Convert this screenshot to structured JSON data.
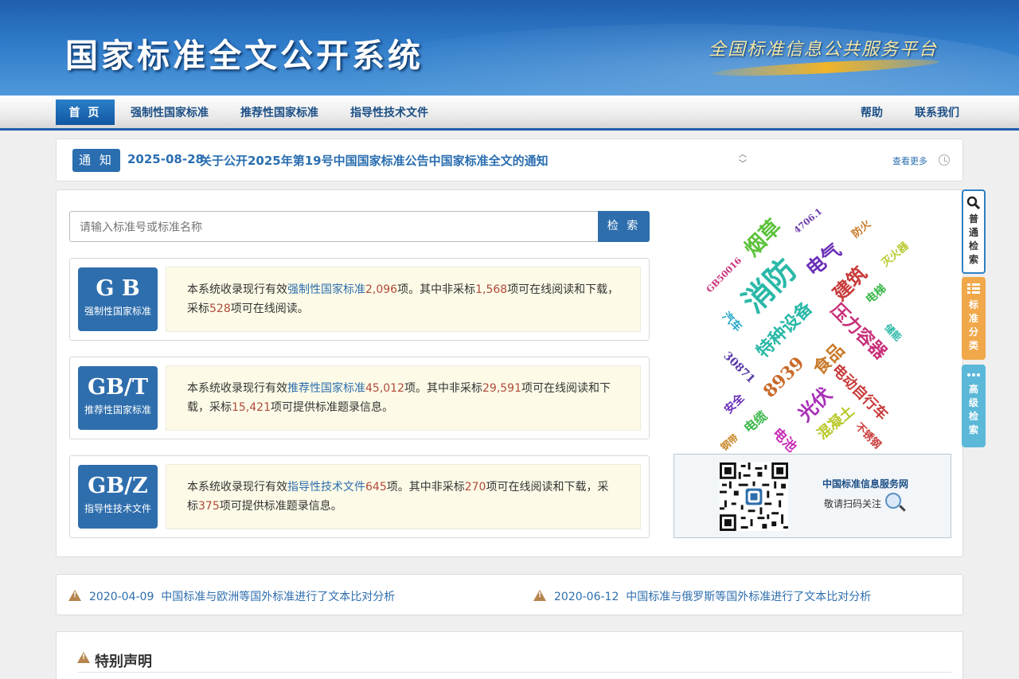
{
  "header": {
    "title": "国家标准全文公开系统",
    "slogan": "全国标准信息公共服务平台"
  },
  "nav": {
    "home": "首 页",
    "mandatory": "强制性国家标准",
    "recommended": "推荐性国家标准",
    "guidance": "指导性技术文件",
    "help": "帮助",
    "contact": "联系我们"
  },
  "notice": {
    "tag": "通 知",
    "date": "2025-08-28",
    "message": "关于公开2025年第19号中国国家标准公告中国家标准全文的通知",
    "more": "查看更多"
  },
  "search": {
    "placeholder": "请输入标准号或标准名称",
    "button": "检 索"
  },
  "cards": [
    {
      "code": "G B",
      "label": "强制性国家标准",
      "p1": "本系统收录现行有效",
      "link": "强制性国家标准",
      "total": "2,096",
      "p2": "项。其中非采标",
      "non_adopted": "1,568",
      "p3": "项可在线阅读和下载，采标",
      "adopted": "528",
      "p4": "项可在线阅读。"
    },
    {
      "code": "GB/T",
      "label": "推荐性国家标准",
      "p1": "本系统收录现行有效",
      "link": "推荐性国家标准",
      "total": "45,012",
      "p2": "项。其中非采标",
      "non_adopted": "29,591",
      "p3": "项可在线阅读和下载，采标",
      "adopted": "15,421",
      "p4": "项可提供标准题录信息。"
    },
    {
      "code": "GB/Z",
      "label": "指导性技术文件",
      "p1": "本系统收录现行有效",
      "link": "指导性技术文件",
      "total": "645",
      "p2": "项。其中非采标",
      "non_adopted": "270",
      "p3": "项可在线阅读和下载，采标",
      "adopted": "375",
      "p4": "项可提供标准题录信息。"
    }
  ],
  "tag_cloud": [
    {
      "text": "烟草",
      "color": "#5cc23a"
    },
    {
      "text": "4706.1",
      "color": "#6a3aa8"
    },
    {
      "text": "防火",
      "color": "#c87a2a"
    },
    {
      "text": "电气",
      "color": "#6a2fb8"
    },
    {
      "text": "灭火器",
      "color": "#b8c82a"
    },
    {
      "text": "GB50016",
      "color": "#c8307a"
    },
    {
      "text": "消防",
      "color": "#2ab8a8"
    },
    {
      "text": "建筑",
      "color": "#c83a3a"
    },
    {
      "text": "电梯",
      "color": "#3ab84a"
    },
    {
      "text": "汽车",
      "color": "#2aa8c8"
    },
    {
      "text": "特种设备",
      "color": "#2ab8a8"
    },
    {
      "text": "压力容器",
      "color": "#c8307a"
    },
    {
      "text": "储能",
      "color": "#2ab8a8"
    },
    {
      "text": "30871",
      "color": "#5a3aa8"
    },
    {
      "text": "食品",
      "color": "#c87a2a"
    },
    {
      "text": "8939",
      "color": "#c86a2a"
    },
    {
      "text": "电动自行车",
      "color": "#c83a3a"
    },
    {
      "text": "安全",
      "color": "#6a2fb8"
    },
    {
      "text": "光伏",
      "color": "#a82fb8"
    },
    {
      "text": "电缆",
      "color": "#3ab84a"
    },
    {
      "text": "混凝土",
      "color": "#b8c82a"
    },
    {
      "text": "钢带",
      "color": "#c8882a"
    },
    {
      "text": "电池",
      "color": "#c82fb8"
    },
    {
      "text": "不锈钢",
      "color": "#c83a3a"
    }
  ],
  "qr": {
    "title": "中国标准信息服务网",
    "subtitle": "敬请扫码关注"
  },
  "side_buttons": [
    {
      "label": "普通检索"
    },
    {
      "label": "标准分类"
    },
    {
      "label": "高级检索"
    }
  ],
  "analysis": [
    {
      "date": "2020-04-09",
      "text": "中国标准与欧洲等国外标准进行了文本比对分析"
    },
    {
      "date": "2020-06-12",
      "text": "中国标准与俄罗斯等国外标准进行了文本比对分析"
    }
  ],
  "declaration": {
    "title": "特别声明"
  }
}
